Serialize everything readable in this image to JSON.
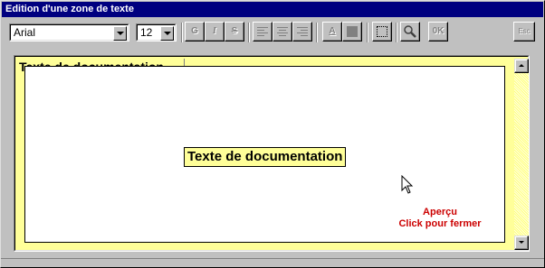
{
  "window": {
    "title": "Edition d'une zone de texte"
  },
  "toolbar": {
    "font": {
      "value": "Arial"
    },
    "size": {
      "value": "12"
    },
    "bold_label": "G",
    "italic_label": "I",
    "strike_label": "S",
    "color_text_label": "A",
    "ok_label": "0K",
    "esc_label": "Esc"
  },
  "editor": {
    "background_text": "Texte de documentation",
    "preview_text": "Texte de documentation",
    "preview_hint_line1": "Aperçu",
    "preview_hint_line2": "Click pour fermer"
  },
  "colors": {
    "title_bar": "#000080",
    "editor_background": "#ffff99",
    "hint_text": "#cc0000"
  }
}
